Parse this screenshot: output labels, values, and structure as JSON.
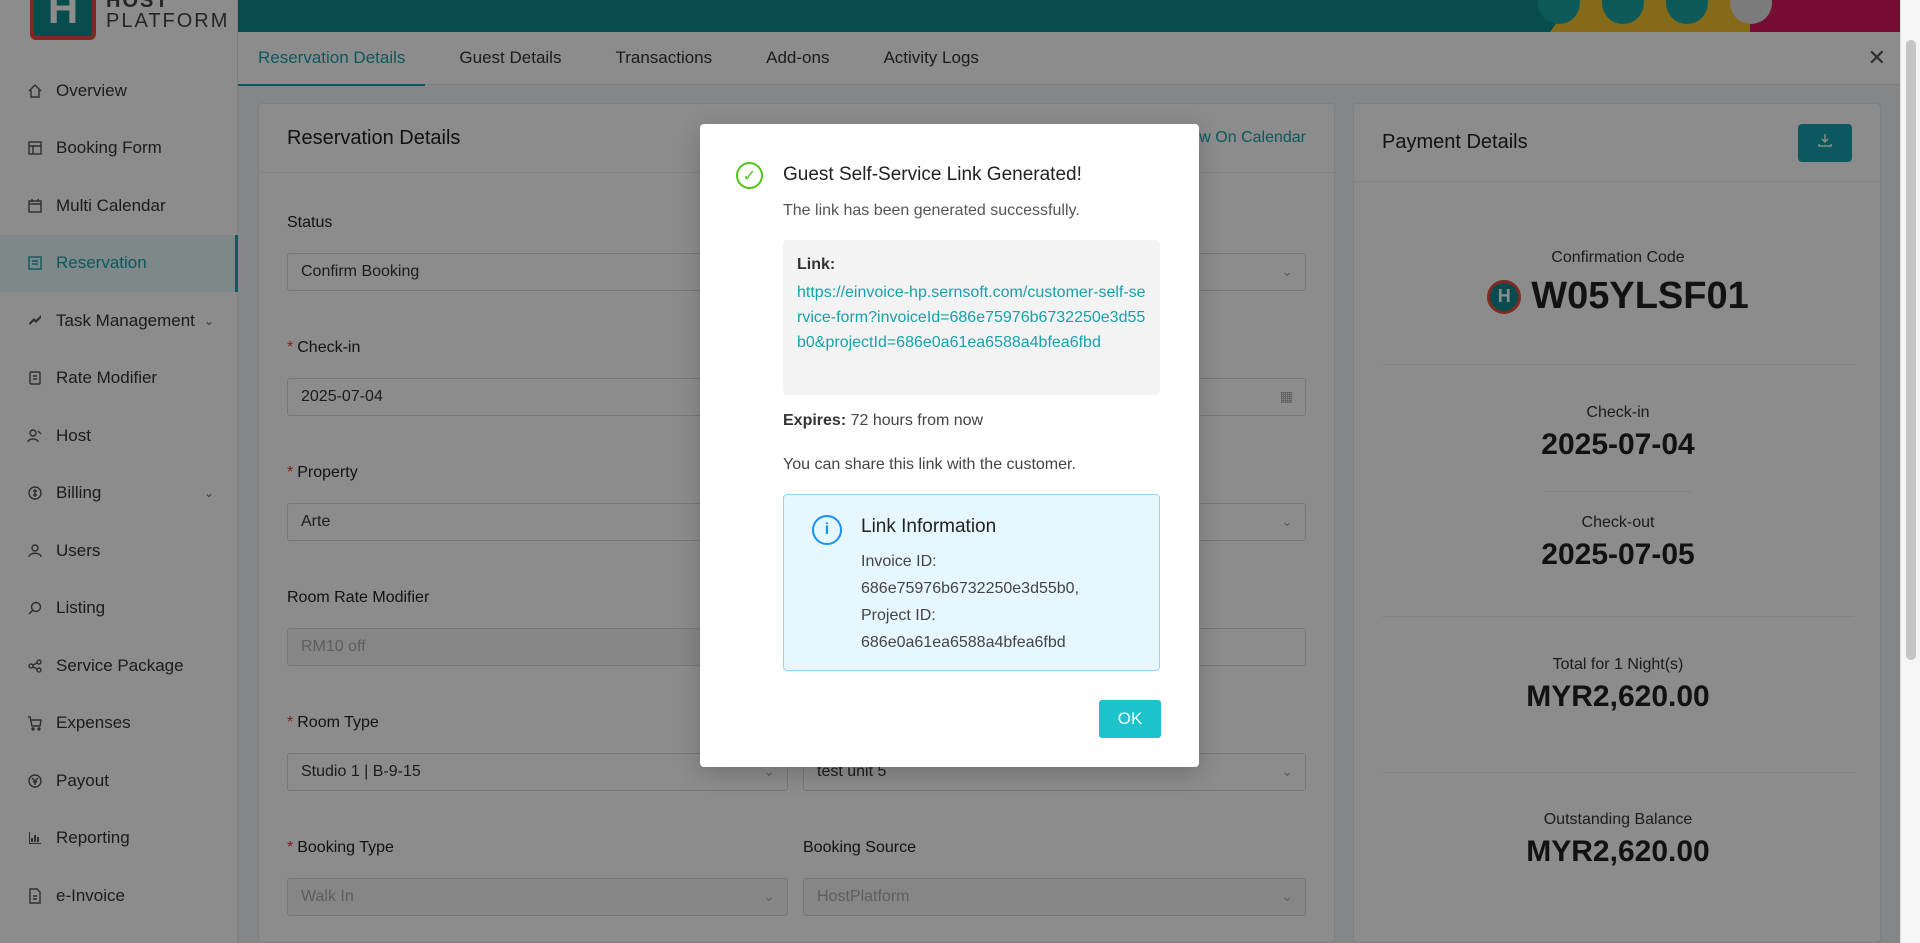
{
  "app": {
    "logo_letter": "H",
    "logo_line1": "HOST",
    "logo_line2": "PLATFORM"
  },
  "sidebar": {
    "items": [
      {
        "label": "Overview",
        "icon": "home-icon"
      },
      {
        "label": "Booking Form",
        "icon": "form-icon"
      },
      {
        "label": "Multi Calendar",
        "icon": "calendar-icon"
      },
      {
        "label": "Reservation",
        "icon": "reservation-icon",
        "active": true
      },
      {
        "label": "Task Management",
        "icon": "task-icon",
        "expandable": true
      },
      {
        "label": "Rate Modifier",
        "icon": "rate-icon"
      },
      {
        "label": "Host",
        "icon": "host-icon"
      },
      {
        "label": "Billing",
        "icon": "billing-icon",
        "expandable": true
      },
      {
        "label": "Users",
        "icon": "user-icon"
      },
      {
        "label": "Listing",
        "icon": "search-icon"
      },
      {
        "label": "Service Package",
        "icon": "share-icon"
      },
      {
        "label": "Expenses",
        "icon": "cart-icon"
      },
      {
        "label": "Payout",
        "icon": "payout-icon"
      },
      {
        "label": "Reporting",
        "icon": "chart-icon"
      },
      {
        "label": "e-Invoice",
        "icon": "invoice-icon"
      }
    ]
  },
  "tabs": [
    "Reservation Details",
    "Guest Details",
    "Transactions",
    "Add-ons",
    "Activity Logs"
  ],
  "reservation": {
    "title": "Reservation Details",
    "view_calendar": "w On Calendar",
    "status_label": "Status",
    "status_value": "Confirm Booking",
    "checkin_label": "Check-in",
    "checkin_value": "2025-07-04",
    "property_label": "Property",
    "property_value": "Arte",
    "rate_modifier_label": "Room Rate Modifier",
    "rate_modifier_value": "RM10 off",
    "room_type_label": "Room Type",
    "room_type_value": "Studio 1 | B-9-15",
    "unit_value": "test unit 5",
    "booking_type_label": "Booking Type",
    "booking_type_value": "Walk In",
    "booking_source_label": "Booking Source",
    "booking_source_value": "HostPlatform"
  },
  "payment": {
    "title": "Payment Details",
    "confirmation_label": "Confirmation Code",
    "confirmation_value": "W05YLSF01",
    "checkin_label": "Check-in",
    "checkin_value": "2025-07-04",
    "checkout_label": "Check-out",
    "checkout_value": "2025-07-05",
    "total_label": "Total for 1 Night(s)",
    "total_value": "MYR2,620.00",
    "outstanding_label": "Outstanding Balance",
    "outstanding_value": "MYR2,620.00"
  },
  "modal": {
    "title": "Guest Self-Service Link Generated!",
    "subtitle": "The link has been generated successfully.",
    "link_label": "Link:",
    "link_url": "https://einvoice-hp.sernsoft.com/customer-self-service-form?invoiceId=686e75976b6732250e3d55b0&projectId=686e0a61ea6588a4bfea6fbd",
    "expires_label": "Expires:",
    "expires_value": " 72 hours from now",
    "share_text": "You can share this link with the customer.",
    "info_title": "Link Information",
    "info_invoice_label": "Invoice ID:",
    "info_invoice_value": "686e75976b6732250e3d55b0,",
    "info_project_label": "Project ID:",
    "info_project_value": "686e0a61ea6588a4bfea6fbd",
    "ok_label": "OK"
  },
  "colors": {
    "accent": "#14a3ab",
    "success": "#52c41a",
    "info": "#1890ff",
    "required": "#e53935"
  }
}
